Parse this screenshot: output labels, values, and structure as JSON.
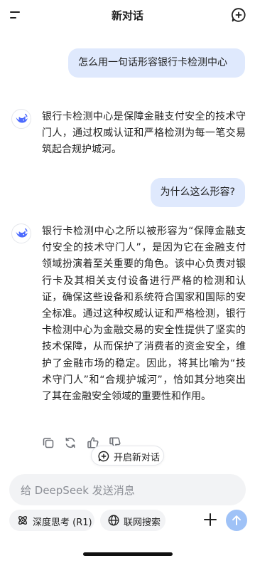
{
  "header": {
    "title": "新对话"
  },
  "conversation": {
    "user_message_1": "怎么用一句话形容银行卡检测中心",
    "ai_message_1": "银行卡检测中心是保障金融支付安全的技术守门人，通过权威认证和严格检测为每一笔交易筑起合规护城河。",
    "user_message_2": "为什么这么形容?",
    "ai_message_2": "银行卡检测中心之所以被形容为“保障金融支付安全的技术守门人”，是因为它在金融支付领域扮演着至关重要的角色。该中心负责对银行卡及其相关支付设备进行严格的检测和认证，确保这些设备和系统符合国家和国际的安全标准。通过这种权威认证和严格检测，银行卡检测中心为金融交易的安全性提供了坚实的技术保障，从而保护了消费者的资金安全，维护了金融市场的稳定。因此，将其比喻为“技术守门人”和“合规护城河”，恰如其分地突出了其在金融安全领域的重要性和作用。"
  },
  "actions": {
    "new_chat_label": "开启新对话"
  },
  "composer": {
    "placeholder": "给 DeepSeek 发送消息",
    "deep_think_label": "深度思考 (R1)",
    "web_search_label": "联网搜索"
  },
  "icons": {
    "menu": "menu-icon",
    "new_chat": "new-chat-icon",
    "logo": "deepseek-whale-logo",
    "copy": "copy-icon",
    "regenerate": "refresh-icon",
    "like": "thumbs-up-icon",
    "dislike": "thumbs-down-icon",
    "deep_think": "atom-icon",
    "web_search": "globe-icon",
    "attach": "plus-icon",
    "send": "arrow-up-icon"
  },
  "colors": {
    "user_bubble": "#dfe9fd",
    "logo_blue": "#4d6bfe",
    "send_button": "#9fc2f7",
    "input_bg": "#f2f3f5"
  }
}
